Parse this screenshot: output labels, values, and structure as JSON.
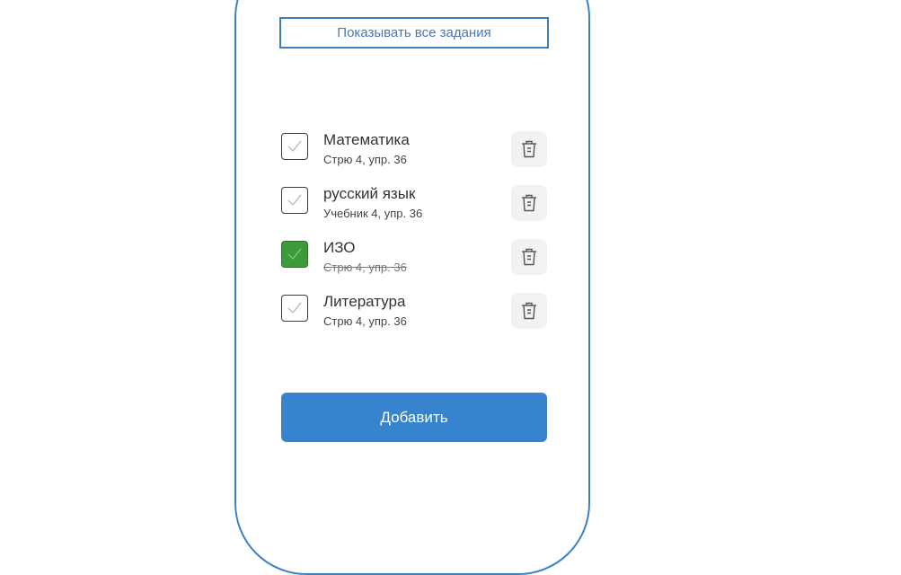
{
  "filter": {
    "label": "Показывать все задания"
  },
  "tasks": [
    {
      "title": "Математика",
      "subtitle": "Стрю 4, упр. 36",
      "done": false
    },
    {
      "title": "русский язык",
      "subtitle": "Учебник 4, упр. 36",
      "done": false
    },
    {
      "title": "ИЗО",
      "subtitle": "Стрю 4, упр. 36",
      "done": true
    },
    {
      "title": "Литература",
      "subtitle": "Стрю 4, упр. 36",
      "done": false
    }
  ],
  "add_button": {
    "label": "Добавить"
  },
  "colors": {
    "accent": "#3783cd",
    "border": "#3b82c4",
    "done_check": "#3c9a3a"
  },
  "icons": {
    "checkbox": "check-icon",
    "delete": "trash-icon"
  }
}
